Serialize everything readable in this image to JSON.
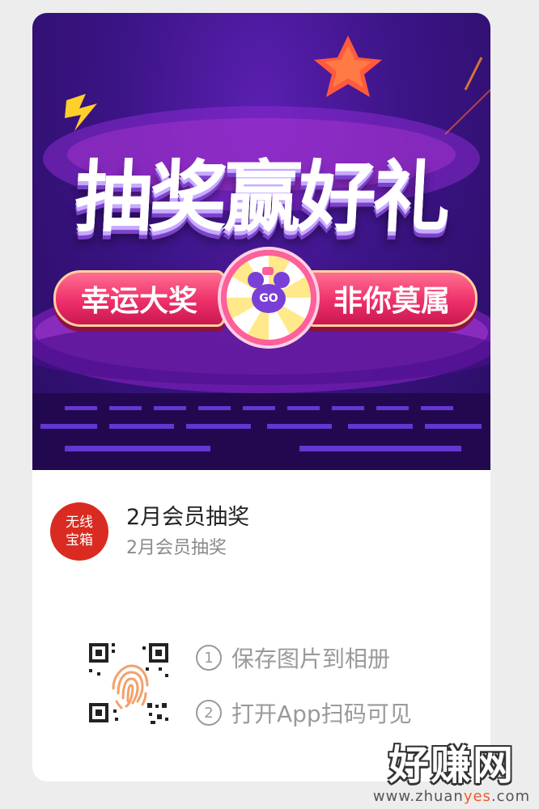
{
  "banner": {
    "title": "抽奖赢好礼",
    "left_pill": "幸运大奖",
    "right_pill": "非你莫属",
    "wheel_button": "GO"
  },
  "app": {
    "logo_line1": "无线",
    "logo_line2": "宝箱",
    "title": "2月会员抽奖",
    "subtitle": "2月会员抽奖"
  },
  "steps": [
    {
      "num": "1",
      "text": "保存图片到相册"
    },
    {
      "num": "2",
      "text": "打开App扫码可见"
    }
  ],
  "watermark": {
    "main": "好赚网",
    "url_prefix": "www.zhuan",
    "url_highlight": "yes",
    "url_suffix": ".com"
  },
  "colors": {
    "background": "#ededed",
    "card": "#ffffff",
    "banner_purple": "#3b1485",
    "pill_pink": "#ee2f6a",
    "logo_red": "#d92b21",
    "fingerprint_orange": "#f5a06a"
  },
  "icons": {
    "qr": "qr-code-icon",
    "fingerprint": "fingerprint-icon",
    "star": "star-icon",
    "lightning": "lightning-icon"
  }
}
